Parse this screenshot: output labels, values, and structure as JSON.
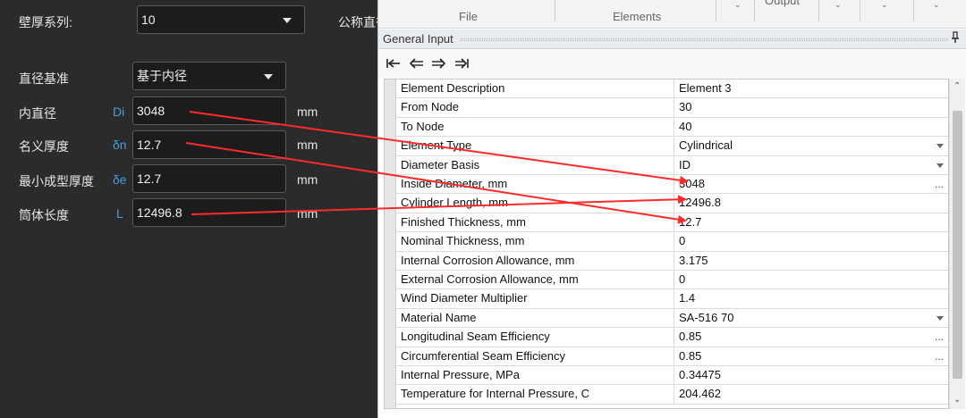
{
  "left_form": {
    "wall_series_label": "壁厚系列:",
    "wall_series_value": "10",
    "nominal_cut_label": "公称直径",
    "diameter_basis_label": "直径基准",
    "diameter_basis_value": "基于内径",
    "fields": [
      {
        "label": "内直径",
        "symbol": "Di",
        "value": "3048",
        "unit": "mm"
      },
      {
        "label": "名义厚度",
        "symbol": "δn",
        "value": "12.7",
        "unit": "mm"
      },
      {
        "label": "最小成型厚度",
        "symbol": "δe",
        "value": "12.7",
        "unit": "mm"
      },
      {
        "label": "筒体长度",
        "symbol": "L",
        "value": "12496.8",
        "unit": "mm"
      }
    ]
  },
  "ribbon": {
    "groups": [
      "File",
      "Elements",
      "Output"
    ]
  },
  "panel": {
    "title": "General Input",
    "pin_icon": "pin-icon",
    "nav_icons": [
      "first-icon",
      "prev-icon",
      "next-icon",
      "last-icon"
    ]
  },
  "grid": {
    "rows": [
      {
        "name": "Element Description",
        "value": "Element  3",
        "editor": "none"
      },
      {
        "name": "From Node",
        "value": "30",
        "editor": "none"
      },
      {
        "name": "To Node",
        "value": "40",
        "editor": "none"
      },
      {
        "name": "Element Type",
        "value": "Cylindrical",
        "editor": "dropdown"
      },
      {
        "name": "Diameter Basis",
        "value": "ID",
        "editor": "dropdown"
      },
      {
        "name": "Inside Diameter, mm",
        "value": "3048",
        "editor": "ellipsis"
      },
      {
        "name": "Cylinder Length, mm",
        "value": "12496.8",
        "editor": "none"
      },
      {
        "name": "Finished Thickness, mm",
        "value": "12.7",
        "editor": "none"
      },
      {
        "name": "Nominal Thickness, mm",
        "value": "0",
        "editor": "none"
      },
      {
        "name": "Internal Corrosion Allowance, mm",
        "value": "3.175",
        "editor": "none"
      },
      {
        "name": "External Corrosion Allowance, mm",
        "value": "0",
        "editor": "none"
      },
      {
        "name": "Wind Diameter Multiplier",
        "value": "1.4",
        "editor": "none"
      },
      {
        "name": "Material Name",
        "value": "SA-516 70",
        "editor": "dropdown"
      },
      {
        "name": "Longitudinal Seam Efficiency",
        "value": "0.85",
        "editor": "ellipsis"
      },
      {
        "name": "Circumferential Seam Efficiency",
        "value": "0.85",
        "editor": "ellipsis"
      },
      {
        "name": "Internal Pressure, MPa",
        "value": "0.34475",
        "editor": "none"
      },
      {
        "name": "Temperature for Internal Pressure, C",
        "value": "204.462",
        "editor": "none"
      }
    ]
  },
  "annotation": {
    "arrow_color": "#ff2a2a"
  }
}
